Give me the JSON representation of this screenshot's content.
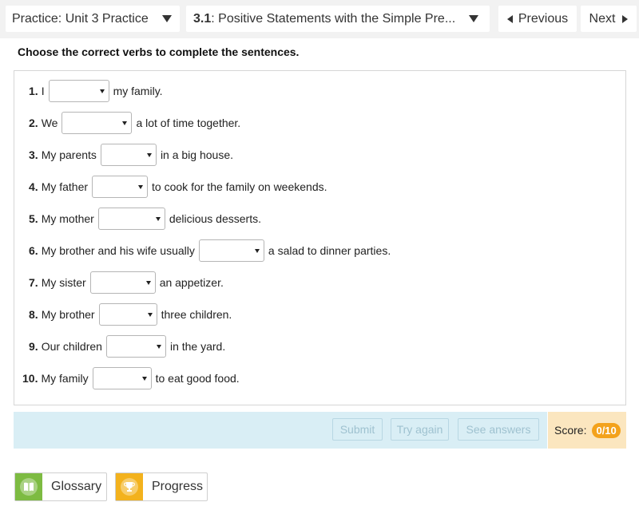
{
  "nav": {
    "unit_label": "Practice: Unit 3 Practice",
    "lesson_num": "3.1",
    "lesson_title": ": Positive Statements with the Simple Pre...",
    "previous_label": "Previous",
    "next_label": "Next"
  },
  "instruction": "Choose the correct verbs to complete the sentences.",
  "questions": [
    {
      "num": "1.",
      "before": "I",
      "after": "my family."
    },
    {
      "num": "2.",
      "before": "We",
      "after": "a lot of time together."
    },
    {
      "num": "3.",
      "before": "My parents",
      "after": "in a big house."
    },
    {
      "num": "4.",
      "before": "My father",
      "after": "to cook for the family on weekends."
    },
    {
      "num": "5.",
      "before": "My mother",
      "after": "delicious desserts."
    },
    {
      "num": "6.",
      "before": "My brother and his wife usually",
      "after": "a salad to dinner parties."
    },
    {
      "num": "7.",
      "before": "My sister",
      "after": "an appetizer."
    },
    {
      "num": "8.",
      "before": "My brother",
      "after": "three children."
    },
    {
      "num": "9.",
      "before": "Our children",
      "after": "in the yard."
    },
    {
      "num": "10.",
      "before": "My family",
      "after": "to eat good food."
    }
  ],
  "actions": {
    "submit_label": "Submit",
    "try_again_label": "Try again",
    "see_answers_label": "See answers",
    "score_label": "Score:",
    "score_value": "0/10"
  },
  "tools": {
    "glossary_label": "Glossary",
    "progress_label": "Progress"
  },
  "colors": {
    "action_bar": "#d9eef5",
    "score_bg": "#fbe6bf",
    "score_badge": "#f3a21c",
    "glossary_icon": "#7dbb42",
    "progress_icon": "#f3b21d"
  }
}
